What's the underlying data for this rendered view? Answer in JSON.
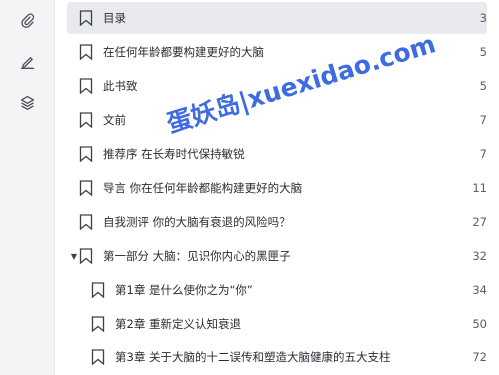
{
  "sidebar": {
    "icons": [
      "paperclip-icon",
      "pen-icon",
      "layers-icon"
    ]
  },
  "toc": {
    "items": [
      {
        "label": "目录",
        "page": "3"
      },
      {
        "label": "在任何年龄都要构建更好的大脑",
        "page": "5"
      },
      {
        "label": "此书致",
        "page": "5"
      },
      {
        "label": "文前",
        "page": "7"
      },
      {
        "label": "推荐序 在长寿时代保持敏锐",
        "page": "7"
      },
      {
        "label": "导言 你在任何年龄都能构建更好的大脑",
        "page": "11"
      },
      {
        "label": "自我测评 你的大脑有衰退的风险吗？",
        "page": "27"
      },
      {
        "label": "第一部分 大脑：见识你内心的黑匣子",
        "page": "32"
      },
      {
        "label": "第1章 是什么使你之为“你”",
        "page": "34"
      },
      {
        "label": "第2章 重新定义认知衰退",
        "page": "50"
      },
      {
        "label": "第3章 关于大脑的十二误传和塑造大脑健康的五大支柱",
        "page": "72"
      }
    ]
  },
  "watermark": "蛋妖岛|xuexidao.com",
  "colors": {
    "accent": "#2f5fe0",
    "active_row": "#e9eaed",
    "rail": "#f3f4f6"
  }
}
